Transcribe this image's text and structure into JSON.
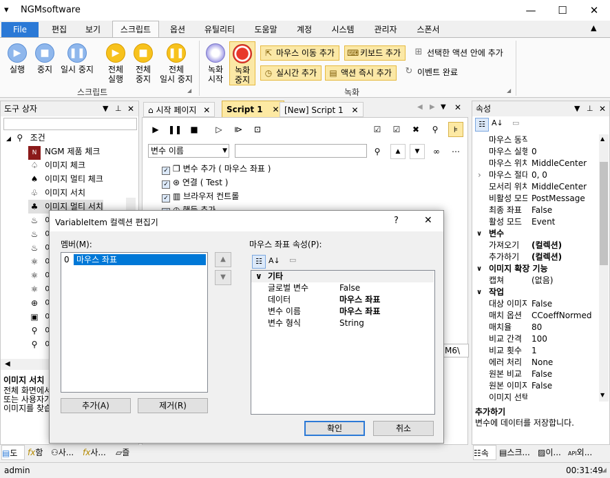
{
  "window": {
    "app_icon": "app-menu-icon",
    "title": "NGMsoftware",
    "minimize": "—",
    "maximize": "☐",
    "close": "✕"
  },
  "ribbon_tabs": [
    "File",
    "편집",
    "보기",
    "스크립트",
    "옵션",
    "유틸리티",
    "도움말",
    "계정",
    "시스템",
    "관리자",
    "스폰서"
  ],
  "ribbon": {
    "run": {
      "l1": "실행",
      "l2": ""
    },
    "stop": {
      "l1": "중지",
      "l2": ""
    },
    "pause": {
      "l1": "일시 중지",
      "l2": ""
    },
    "run_all": {
      "l1": "전체",
      "l2": "실행"
    },
    "stop_all": {
      "l1": "전체",
      "l2": "중지"
    },
    "pause_all": {
      "l1": "전체",
      "l2": "일시 중지"
    },
    "script_group": "스크립트",
    "rec_start": {
      "l1": "녹화",
      "l2": "시작"
    },
    "rec_stop": {
      "l1": "녹화",
      "l2": "중지"
    },
    "mouse_move_add": "마우스 이동 추가",
    "keyboard_add": "키보드 추가",
    "selected_action": "선택한 액션 안에 추가",
    "realtime_add": "실시간 추가",
    "action_now_add": "액션 즉시 추가",
    "event_done": "이벤트 완료",
    "record_group": "녹화"
  },
  "toolbox": {
    "title": "도구 상자",
    "root": "조건",
    "items": [
      "NGM 제품 체크",
      "이미지 체크",
      "이미지 멀티 체크",
      "이미지 서치",
      "이미지 멀티 서치",
      "이",
      "이",
      "이",
      "이",
      "이",
      "이",
      "이",
      "이",
      "이",
      "이",
      "이"
    ],
    "desc_title": "이미지 서치",
    "desc_lines": [
      "전체 화면에서",
      "또는 사용자가",
      "이미지를 찾습"
    ]
  },
  "doc_tabs": {
    "start": "시작 페이지",
    "script1": "Script 1",
    "new_script": "[New] Script 1"
  },
  "editor": {
    "var_combo": "변수 이름",
    "lines": [
      "변수 추가 ( 마우스 좌표 )",
      "연결 ( Test )",
      "브라우저 컨트롤",
      "핸들 추가"
    ],
    "partial_text": "M6\\"
  },
  "properties": {
    "title": "속성",
    "rows": [
      {
        "k": "마우스 동작",
        "v": ""
      },
      {
        "k": "마우스 실행",
        "v": "0"
      },
      {
        "k": "마우스 위치",
        "v": "MiddleCenter"
      },
      {
        "k": "마우스 절대",
        "v": "0, 0"
      },
      {
        "k": "모서리 위치",
        "v": "MiddleCenter"
      },
      {
        "k": "비활성 모드",
        "v": "PostMessage"
      },
      {
        "k": "최종 좌표",
        "v": "False"
      },
      {
        "k": "활성 모드",
        "v": "Event"
      }
    ],
    "cat_var": "변수",
    "var_rows": [
      {
        "k": "가져오기",
        "v": "(컬렉션)"
      },
      {
        "k": "추가하기",
        "v": "(컬렉션)"
      }
    ],
    "cat_image": "이미지 확장 기능",
    "image_rows": [
      {
        "k": "캡쳐",
        "v": "(없음)"
      }
    ],
    "cat_work": "작업",
    "work_rows": [
      {
        "k": "대상 이미지",
        "v": "False"
      },
      {
        "k": "매치 옵션",
        "v": "CCoeffNormed"
      },
      {
        "k": "매치율",
        "v": "80"
      },
      {
        "k": "비교 간격",
        "v": "100"
      },
      {
        "k": "비교 횟수",
        "v": "1"
      },
      {
        "k": "에러 처리",
        "v": "None"
      },
      {
        "k": "원본 비교",
        "v": "False"
      },
      {
        "k": "원본 이미지",
        "v": "False"
      },
      {
        "k": "이미지 선택",
        "v": ""
      }
    ],
    "help_title": "추가하기",
    "help_text": "변수에 데이터를 저장합니다."
  },
  "dialog": {
    "title": "VariableItem 컬렉션 편집기",
    "help": "?",
    "close": "✕",
    "members_label": "멤버(M):",
    "member_index": "0",
    "member_value": "마우스 좌표",
    "props_label": "마우스 좌표 속성(P):",
    "category": "기타",
    "rows": [
      {
        "k": "글로벌 변수",
        "v": "False"
      },
      {
        "k": "데이터",
        "v": "마우스 좌표"
      },
      {
        "k": "변수 이름",
        "v": "마우스 좌표"
      },
      {
        "k": "변수 형식",
        "v": "String"
      }
    ],
    "add": "추가(A)",
    "remove": "제거(R)",
    "ok": "확인",
    "cancel": "취소"
  },
  "bottom_tabs_left": [
    "도",
    "함",
    "사...",
    "사...",
    "즐"
  ],
  "bottom_tabs_right": [
    "속",
    "스크...",
    "이...",
    "외..."
  ],
  "status": {
    "user": "admin",
    "time": "00:31:49"
  },
  "accent": "#2b79d6"
}
